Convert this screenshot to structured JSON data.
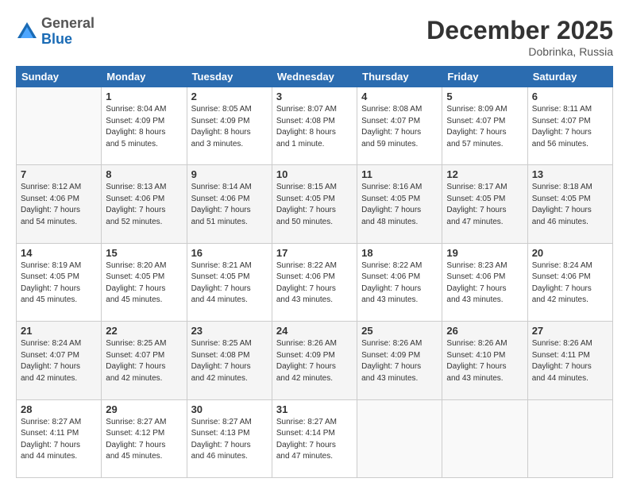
{
  "header": {
    "logo_general": "General",
    "logo_blue": "Blue",
    "month_title": "December 2025",
    "location": "Dobrinka, Russia"
  },
  "days_of_week": [
    "Sunday",
    "Monday",
    "Tuesday",
    "Wednesday",
    "Thursday",
    "Friday",
    "Saturday"
  ],
  "weeks": [
    [
      {
        "day": "",
        "info": ""
      },
      {
        "day": "1",
        "info": "Sunrise: 8:04 AM\nSunset: 4:09 PM\nDaylight: 8 hours\nand 5 minutes."
      },
      {
        "day": "2",
        "info": "Sunrise: 8:05 AM\nSunset: 4:09 PM\nDaylight: 8 hours\nand 3 minutes."
      },
      {
        "day": "3",
        "info": "Sunrise: 8:07 AM\nSunset: 4:08 PM\nDaylight: 8 hours\nand 1 minute."
      },
      {
        "day": "4",
        "info": "Sunrise: 8:08 AM\nSunset: 4:07 PM\nDaylight: 7 hours\nand 59 minutes."
      },
      {
        "day": "5",
        "info": "Sunrise: 8:09 AM\nSunset: 4:07 PM\nDaylight: 7 hours\nand 57 minutes."
      },
      {
        "day": "6",
        "info": "Sunrise: 8:11 AM\nSunset: 4:07 PM\nDaylight: 7 hours\nand 56 minutes."
      }
    ],
    [
      {
        "day": "7",
        "info": "Sunrise: 8:12 AM\nSunset: 4:06 PM\nDaylight: 7 hours\nand 54 minutes."
      },
      {
        "day": "8",
        "info": "Sunrise: 8:13 AM\nSunset: 4:06 PM\nDaylight: 7 hours\nand 52 minutes."
      },
      {
        "day": "9",
        "info": "Sunrise: 8:14 AM\nSunset: 4:06 PM\nDaylight: 7 hours\nand 51 minutes."
      },
      {
        "day": "10",
        "info": "Sunrise: 8:15 AM\nSunset: 4:05 PM\nDaylight: 7 hours\nand 50 minutes."
      },
      {
        "day": "11",
        "info": "Sunrise: 8:16 AM\nSunset: 4:05 PM\nDaylight: 7 hours\nand 48 minutes."
      },
      {
        "day": "12",
        "info": "Sunrise: 8:17 AM\nSunset: 4:05 PM\nDaylight: 7 hours\nand 47 minutes."
      },
      {
        "day": "13",
        "info": "Sunrise: 8:18 AM\nSunset: 4:05 PM\nDaylight: 7 hours\nand 46 minutes."
      }
    ],
    [
      {
        "day": "14",
        "info": "Sunrise: 8:19 AM\nSunset: 4:05 PM\nDaylight: 7 hours\nand 45 minutes."
      },
      {
        "day": "15",
        "info": "Sunrise: 8:20 AM\nSunset: 4:05 PM\nDaylight: 7 hours\nand 45 minutes."
      },
      {
        "day": "16",
        "info": "Sunrise: 8:21 AM\nSunset: 4:05 PM\nDaylight: 7 hours\nand 44 minutes."
      },
      {
        "day": "17",
        "info": "Sunrise: 8:22 AM\nSunset: 4:06 PM\nDaylight: 7 hours\nand 43 minutes."
      },
      {
        "day": "18",
        "info": "Sunrise: 8:22 AM\nSunset: 4:06 PM\nDaylight: 7 hours\nand 43 minutes."
      },
      {
        "day": "19",
        "info": "Sunrise: 8:23 AM\nSunset: 4:06 PM\nDaylight: 7 hours\nand 43 minutes."
      },
      {
        "day": "20",
        "info": "Sunrise: 8:24 AM\nSunset: 4:06 PM\nDaylight: 7 hours\nand 42 minutes."
      }
    ],
    [
      {
        "day": "21",
        "info": "Sunrise: 8:24 AM\nSunset: 4:07 PM\nDaylight: 7 hours\nand 42 minutes."
      },
      {
        "day": "22",
        "info": "Sunrise: 8:25 AM\nSunset: 4:07 PM\nDaylight: 7 hours\nand 42 minutes."
      },
      {
        "day": "23",
        "info": "Sunrise: 8:25 AM\nSunset: 4:08 PM\nDaylight: 7 hours\nand 42 minutes."
      },
      {
        "day": "24",
        "info": "Sunrise: 8:26 AM\nSunset: 4:09 PM\nDaylight: 7 hours\nand 42 minutes."
      },
      {
        "day": "25",
        "info": "Sunrise: 8:26 AM\nSunset: 4:09 PM\nDaylight: 7 hours\nand 43 minutes."
      },
      {
        "day": "26",
        "info": "Sunrise: 8:26 AM\nSunset: 4:10 PM\nDaylight: 7 hours\nand 43 minutes."
      },
      {
        "day": "27",
        "info": "Sunrise: 8:26 AM\nSunset: 4:11 PM\nDaylight: 7 hours\nand 44 minutes."
      }
    ],
    [
      {
        "day": "28",
        "info": "Sunrise: 8:27 AM\nSunset: 4:11 PM\nDaylight: 7 hours\nand 44 minutes."
      },
      {
        "day": "29",
        "info": "Sunrise: 8:27 AM\nSunset: 4:12 PM\nDaylight: 7 hours\nand 45 minutes."
      },
      {
        "day": "30",
        "info": "Sunrise: 8:27 AM\nSunset: 4:13 PM\nDaylight: 7 hours\nand 46 minutes."
      },
      {
        "day": "31",
        "info": "Sunrise: 8:27 AM\nSunset: 4:14 PM\nDaylight: 7 hours\nand 47 minutes."
      },
      {
        "day": "",
        "info": ""
      },
      {
        "day": "",
        "info": ""
      },
      {
        "day": "",
        "info": ""
      }
    ]
  ]
}
